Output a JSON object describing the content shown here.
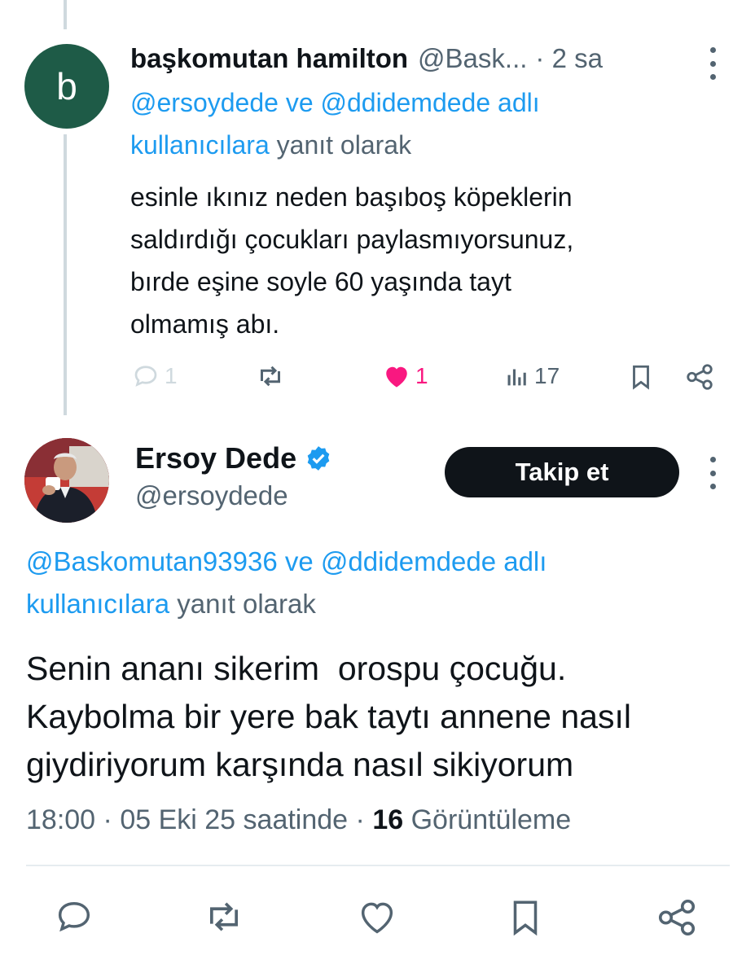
{
  "reply_tweet": {
    "avatar_letter": "b",
    "avatar_color": "#1e5b47",
    "display_name": "başkomutan hamilton",
    "handle": "@Bask...",
    "time": "· 2 sa",
    "replying_to": {
      "user1": "@ersoydede",
      "connector": "ve",
      "user2": "@ddidemdede adlı",
      "users_word": "kullanıcılara",
      "suffix": "yanıt olarak"
    },
    "text_lines": [
      "esinle ıkınız neden başıboş köpeklerin",
      "saldırdığı çocukları paylasmıyorsunuz,",
      "bırde eşine soyle 60 yaşında tayt",
      "olmamış abı."
    ],
    "actions": {
      "reply_icon": "reply-icon",
      "reply_count": "1",
      "retweet_icon": "retweet-icon",
      "like_icon": "heart-filled-icon",
      "like_count": "1",
      "like_color": "#f91880",
      "views_icon": "views-icon",
      "views_count": "17",
      "bookmark_icon": "bookmark-icon",
      "share_icon": "share-icon"
    }
  },
  "main_tweet": {
    "display_name": "Ersoy Dede",
    "handle": "@ersoydede",
    "verified_icon": "verified-badge-icon",
    "follow_label": "Takip et",
    "replying_to": {
      "user1": "@Baskomutan93936",
      "connector": "ve",
      "user2": "@ddidemdede adlı",
      "users_word": "kullanıcılara",
      "suffix": "yanıt olarak"
    },
    "text_lines": [
      "Senin ananı sikerim  orospu çocuğu.",
      "Kaybolma bir yere bak taytı annene nasıl",
      "giydiriyorum karşında nasıl sikiyorum"
    ],
    "meta": {
      "time": "18:00",
      "dot1": "·",
      "date": "05 Eki 25 saatinde",
      "dot2": "·",
      "views_count": "16",
      "views_label": "Görüntüleme"
    }
  },
  "colors": {
    "link": "#1d9bf0",
    "secondary_text": "#536471",
    "primary_text": "#0f1419",
    "verified": "#1d9bf0"
  }
}
